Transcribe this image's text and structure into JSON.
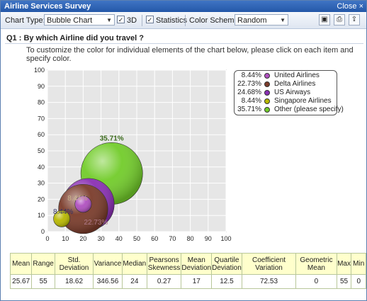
{
  "window": {
    "title": "Airline Services Survey",
    "close_label": "Close ×"
  },
  "toolbar": {
    "chart_type_label": "Chart Type:",
    "chart_type_value": "Bubble Chart",
    "threed_label": "3D",
    "threed_checked": true,
    "statistics_label": "Statistics",
    "statistics_checked": true,
    "color_scheme_label": "Color Scheme:",
    "color_scheme_value": "Random",
    "buttons": [
      "save-icon",
      "print-icon",
      "export-icon"
    ]
  },
  "question": "Q1 : By which Airline did you travel ?",
  "hint": "To customize the color for individual elements of the chart below, please click on each item and specify color.",
  "chart_data": {
    "type": "scatter",
    "title": "",
    "xlabel": "",
    "ylabel": "",
    "xlim": [
      0,
      100
    ],
    "ylim": [
      0,
      100
    ],
    "x_ticks": [
      0,
      10,
      20,
      30,
      40,
      50,
      60,
      70,
      80,
      90,
      100
    ],
    "y_ticks": [
      0,
      10,
      20,
      30,
      40,
      50,
      60,
      70,
      80,
      90,
      100
    ],
    "grid": true,
    "legend_position": "right",
    "series": [
      {
        "name": "United Airlines",
        "percent_label": "8.44%",
        "data_label": "8.44%",
        "x": 20,
        "y": 17,
        "size": 8.44,
        "color": "#b050c0"
      },
      {
        "name": "Delta Airlines",
        "percent_label": "22.73%",
        "data_label": "22.73%",
        "x": 20,
        "y": 14,
        "size": 22.73,
        "color": "#7a3b2a"
      },
      {
        "name": "US Airways",
        "percent_label": "24.68%",
        "data_label": "",
        "x": 23,
        "y": 17,
        "size": 24.68,
        "color": "#8a2fb4"
      },
      {
        "name": "Singapore Airlines",
        "percent_label": "8.44%",
        "data_label": "8.44%",
        "x": 8,
        "y": 8,
        "size": 8.44,
        "color": "#b8b800"
      },
      {
        "name": "Other (please specify)",
        "percent_label": "35.71%",
        "data_label": "35.71%",
        "x": 36,
        "y": 36,
        "size": 35.71,
        "color": "#72cc2a"
      }
    ]
  },
  "stats": {
    "headers": [
      "Mean",
      "Range",
      "Std. Deviation",
      "Variance",
      "Median",
      "Pearsons Skewness",
      "Mean Deviation",
      "Quartile Deviation",
      "Coefficient Variation",
      "Geometric Mean",
      "Max",
      "Min"
    ],
    "values": [
      "25.67",
      "55",
      "18.62",
      "346.56",
      "24",
      "0.27",
      "17",
      "12.5",
      "72.53",
      "0",
      "55",
      "0"
    ]
  }
}
